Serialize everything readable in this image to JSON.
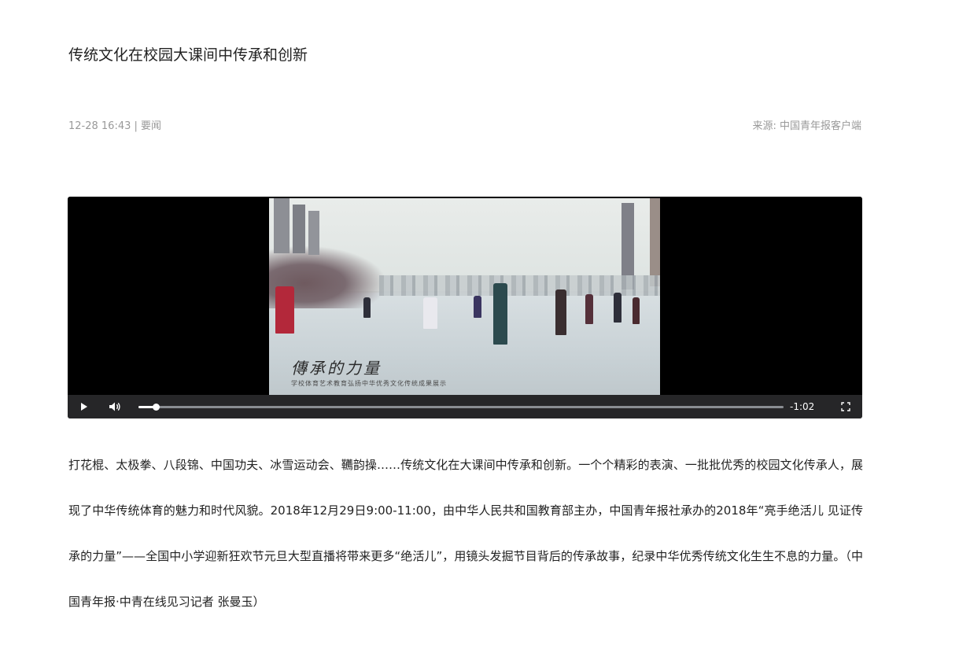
{
  "article": {
    "title": "传统文化在校园大课间中传承和创新",
    "meta_time": "12-28 16:43",
    "meta_separator": "|",
    "meta_category": "要闻",
    "source": "来源: 中国青年报客户端",
    "body": "打花棍、太极拳、八段锦、中国功夫、冰雪运动会、韉韵操……传统文化在大课间中传承和创新。一个个精彩的表演、一批批优秀的校园文化传承人，展现了中华传统体育的魅力和时代风貌。2018年12月29日9:00-11:00，由中华人民共和国教育部主办，中国青年报社承办的2018年“亮手绝活儿 见证传承的力量”——全国中小学迎新狂欢节元旦大型直播将带来更多“绝活儿”，用镜头发掘节目背后的传承故事，纪录中华优秀传统文化生生不息的力量。（中国青年报·中青在线见习记者 张曼玉）"
  },
  "video": {
    "overlay_title": "傳承的力量",
    "overlay_subtitle": "学校体育艺术教育弘扬中华优秀文化传统成果展示",
    "progress": 0.027,
    "time_remaining": "-1:02",
    "icons": {
      "play": "play-icon",
      "volume": "volume-icon",
      "fullscreen": "fullscreen-icon"
    }
  }
}
